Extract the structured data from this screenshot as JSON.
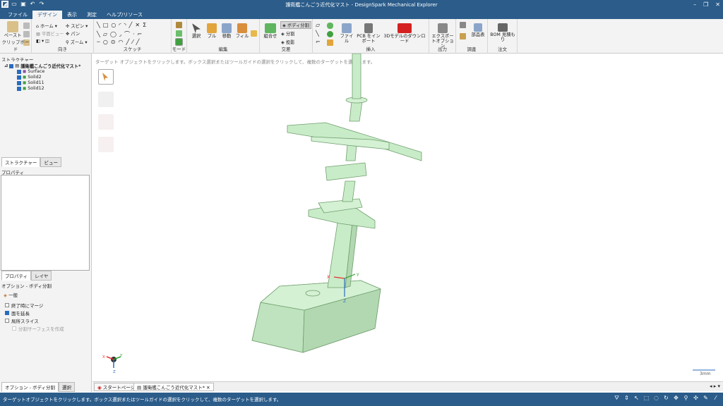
{
  "app": {
    "title": "護衛艦こんごう近代化マスト - DesignSpark Mechanical Explorer"
  },
  "menu": {
    "tabs": [
      "ファイル",
      "デザイン",
      "表示",
      "測定",
      "ヘルプ/リソース"
    ],
    "active": "デザイン"
  },
  "ribbon": {
    "clipboard": {
      "paste": "ペースト",
      "label": "クリップボード"
    },
    "orient": {
      "home": "ホーム",
      "plane": "平面ビュー",
      "spin": "スピン",
      "pan": "パン",
      "zoom": "ズーム",
      "label": "向き"
    },
    "sketch": {
      "label": "スケッチ"
    },
    "mode": {
      "label": "モード"
    },
    "edit": {
      "select": "選択",
      "pull": "プル",
      "move": "移動",
      "fill": "フィル",
      "label": "編集"
    },
    "intersect": {
      "combine": "組合せ",
      "split_body": "ボディ分割",
      "split": "分割",
      "project": "投影",
      "label": "交差"
    },
    "insert": {
      "file": "ファイル",
      "pcb": "PCB をインポート",
      "dl3d": "3Dモデルのダウンロード",
      "label": "挿入"
    },
    "output": {
      "export": "エクスポートオプション",
      "label": "出力"
    },
    "inspect": {
      "parts": "部品表",
      "label": "調査"
    },
    "order": {
      "bom": "BOM 見積もり",
      "label": "注文"
    }
  },
  "structure": {
    "header": "ストラクチャー",
    "root": "護衛艦こんごう近代化マスト*",
    "items": [
      "Surface",
      "Solid2",
      "Solid11",
      "Solid12"
    ],
    "tabs": [
      "ストラクチャー",
      "ビュー"
    ]
  },
  "properties": {
    "header": "プロパティ",
    "tabs": [
      "プロパティ",
      "レイヤ"
    ]
  },
  "options": {
    "header": "オプション - ボディ分割",
    "general": "一般",
    "items": [
      {
        "label": "終了時にマージ",
        "checked": false
      },
      {
        "label": "面を延長",
        "checked": true
      },
      {
        "label": "局所スライス",
        "checked": false
      },
      {
        "label": "分割サーフェスを作成",
        "checked": false
      }
    ],
    "tabs": [
      "オプション - ボディ分割",
      "選択"
    ]
  },
  "viewport": {
    "hint": "ターゲット オブジェクトをクリックします。ボックス選択またはツールガイドの選択をクリックして、複数のターゲットを選択します。",
    "scale": "3mm",
    "model_color": "#c9ecc8",
    "edge_color": "#6f9e6d"
  },
  "doctabs": {
    "start": "スタートページ",
    "doc": "護衛艦こんごう近代化マスト*"
  },
  "status": {
    "message": "ターゲットオブジェクトをクリックします。ボックス選択またはツールガイドの選択をクリックして、複数のターゲットを選択します。"
  }
}
